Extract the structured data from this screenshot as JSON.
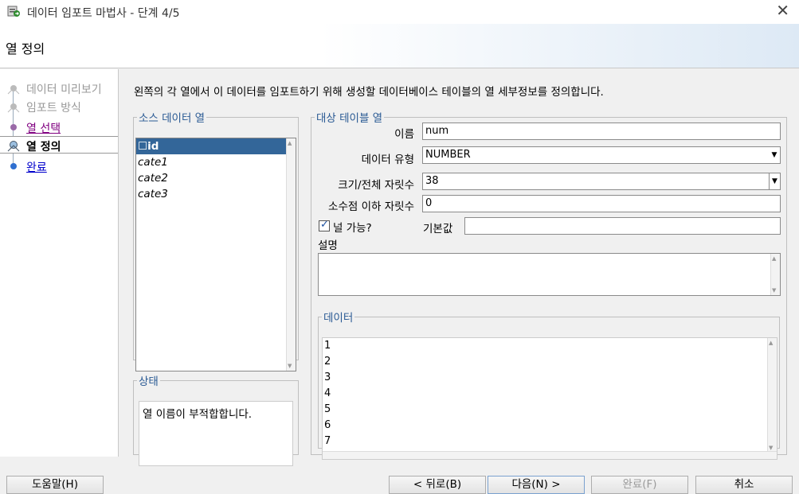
{
  "window": {
    "title": "데이터 임포트 마법사 - 단계 4/5",
    "close_glyph": "✕"
  },
  "header": {
    "title": "열 정의"
  },
  "steps": [
    {
      "label": "데이터 미리보기",
      "state": "done"
    },
    {
      "label": "임포트 방식",
      "state": "done"
    },
    {
      "label": "열 선택",
      "state": "visited"
    },
    {
      "label": "열 정의",
      "state": "current"
    },
    {
      "label": "완료",
      "state": "next"
    }
  ],
  "instruction": "왼쪽의 각 열에서 이 데이터를 임포트하기 위해 생성할 데이터베이스 테이블의 열 세부정보를 정의합니다.",
  "source": {
    "legend": "소스 데이터 열",
    "items": [
      {
        "label": "☐id",
        "selected": true
      },
      {
        "label": "cate1"
      },
      {
        "label": "cate2"
      },
      {
        "label": "cate3"
      }
    ]
  },
  "status": {
    "legend": "상태",
    "message": "열 이름이 부적합합니다."
  },
  "target": {
    "legend": "대상 테이블 열",
    "name_label": "이름",
    "name_value": "num",
    "type_label": "데이터 유형",
    "type_value": "NUMBER",
    "size_label": "크기/전체 자릿수",
    "size_value": "38",
    "scale_label": "소수점 이하 자릿수",
    "scale_value": "0",
    "nullable_label": "널 가능?",
    "nullable_checked": true,
    "default_label": "기본값",
    "default_value": "",
    "comment_label": "설명",
    "data_legend": "데이터",
    "data_rows": [
      "1",
      "2",
      "3",
      "4",
      "5",
      "6",
      "7"
    ]
  },
  "buttons": {
    "help": "도움말(H)",
    "back": "< 뒤로(B)",
    "next": "다음(N) >",
    "finish": "완료(F)",
    "cancel": "취소"
  },
  "icons": {
    "app": "import-wizard-icon",
    "scroll_up": "▲",
    "scroll_down": "▼",
    "dropdown": "▼"
  },
  "colors": {
    "selection": "#336699",
    "legend": "#2a5a94",
    "visited_link": "#800080",
    "link": "#0000cc"
  }
}
